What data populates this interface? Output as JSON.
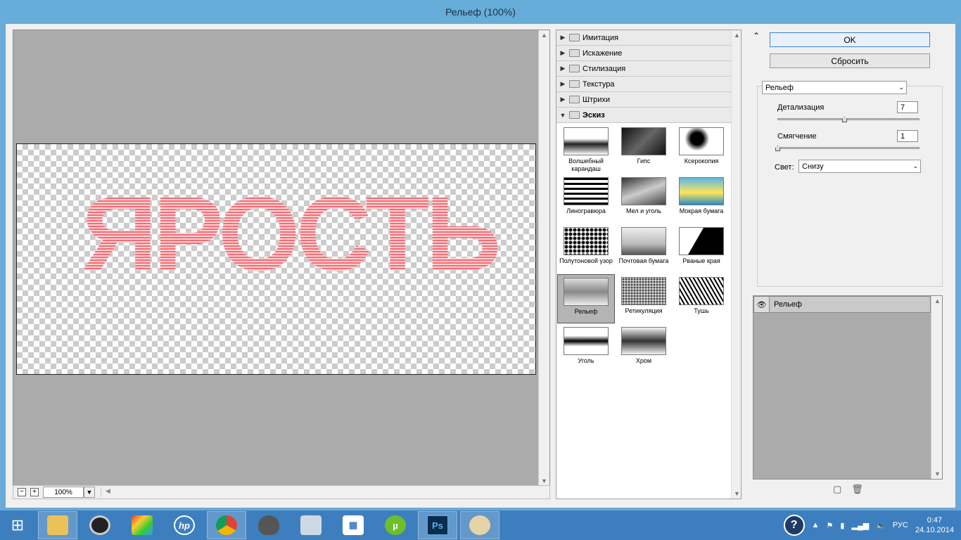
{
  "window": {
    "title": "Рельеф (100%)"
  },
  "preview": {
    "art_text": "ЯРОСТЬ",
    "zoom": "100%",
    "zoom_minus": "−",
    "zoom_plus": "+"
  },
  "gallery": {
    "categories": [
      {
        "label": "Имитация",
        "expanded": false
      },
      {
        "label": "Искажение",
        "expanded": false
      },
      {
        "label": "Стилизация",
        "expanded": false
      },
      {
        "label": "Текстура",
        "expanded": false
      },
      {
        "label": "Штрихи",
        "expanded": false
      },
      {
        "label": "Эскиз",
        "expanded": true
      }
    ],
    "filters": [
      {
        "label": "Волшебный карандаш"
      },
      {
        "label": "Гипс"
      },
      {
        "label": "Ксерокопия"
      },
      {
        "label": "Линогравюра"
      },
      {
        "label": "Мел и уголь"
      },
      {
        "label": "Мокрая бумага"
      },
      {
        "label": "Полутоновой узор"
      },
      {
        "label": "Почтовая бумага"
      },
      {
        "label": "Рваные края"
      },
      {
        "label": "Рельеф",
        "selected": true
      },
      {
        "label": "Ретикуляция"
      },
      {
        "label": "Тушь"
      },
      {
        "label": "Уголь"
      },
      {
        "label": "Хром"
      }
    ]
  },
  "buttons": {
    "ok": "OK",
    "reset": "Сбросить"
  },
  "settings": {
    "filter_select": "Рельеф",
    "detail_label": "Детализация",
    "detail_value": "7",
    "detail_level": 0.47,
    "smooth_label": "Смягчение",
    "smooth_value": "1",
    "smooth_level": 0.0,
    "light_label": "Свет:",
    "light_value": "Снизу"
  },
  "layers": {
    "items": [
      {
        "label": "Рельеф"
      }
    ]
  },
  "taskbar": {
    "lang": "РУС",
    "time": "0:47",
    "date": "24.10.2014"
  },
  "colors": {
    "titlebar": "#66aed9",
    "taskbar": "#3d7fbe",
    "accent_ok": "#3a80d0"
  }
}
